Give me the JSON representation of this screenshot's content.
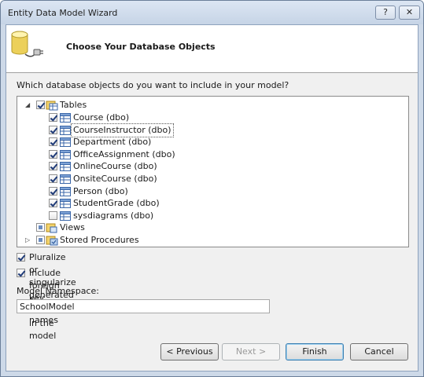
{
  "window": {
    "title": "Entity Data Model Wizard",
    "help_label": "?",
    "close_label": "✕"
  },
  "header": {
    "title": "Choose Your Database Objects",
    "icon": "database-plug-icon"
  },
  "prompt": "Which database objects do you want to include in your model?",
  "tree": {
    "tables": {
      "label": "Tables",
      "items": [
        {
          "label": "Course (dbo)",
          "checked": true
        },
        {
          "label": "CourseInstructor (dbo)",
          "checked": true,
          "selected": true
        },
        {
          "label": "Department (dbo)",
          "checked": true
        },
        {
          "label": "OfficeAssignment (dbo)",
          "checked": true
        },
        {
          "label": "OnlineCourse (dbo)",
          "checked": true
        },
        {
          "label": "OnsiteCourse (dbo)",
          "checked": true
        },
        {
          "label": "Person (dbo)",
          "checked": true
        },
        {
          "label": "StudentGrade (dbo)",
          "checked": true
        },
        {
          "label": "sysdiagrams (dbo)",
          "checked": false
        }
      ]
    },
    "views": {
      "label": "Views"
    },
    "stored_procedures": {
      "label": "Stored Procedures"
    }
  },
  "options": {
    "pluralize": {
      "label": "Pluralize or singularize generated object names",
      "checked": true
    },
    "foreign_keys": {
      "label": "Include foreign key columns in the model",
      "checked": true
    }
  },
  "namespace": {
    "label": "Model Namespace:",
    "value": "SchoolModel"
  },
  "buttons": {
    "previous": "< Previous",
    "next": "Next >",
    "finish": "Finish",
    "cancel": "Cancel"
  }
}
